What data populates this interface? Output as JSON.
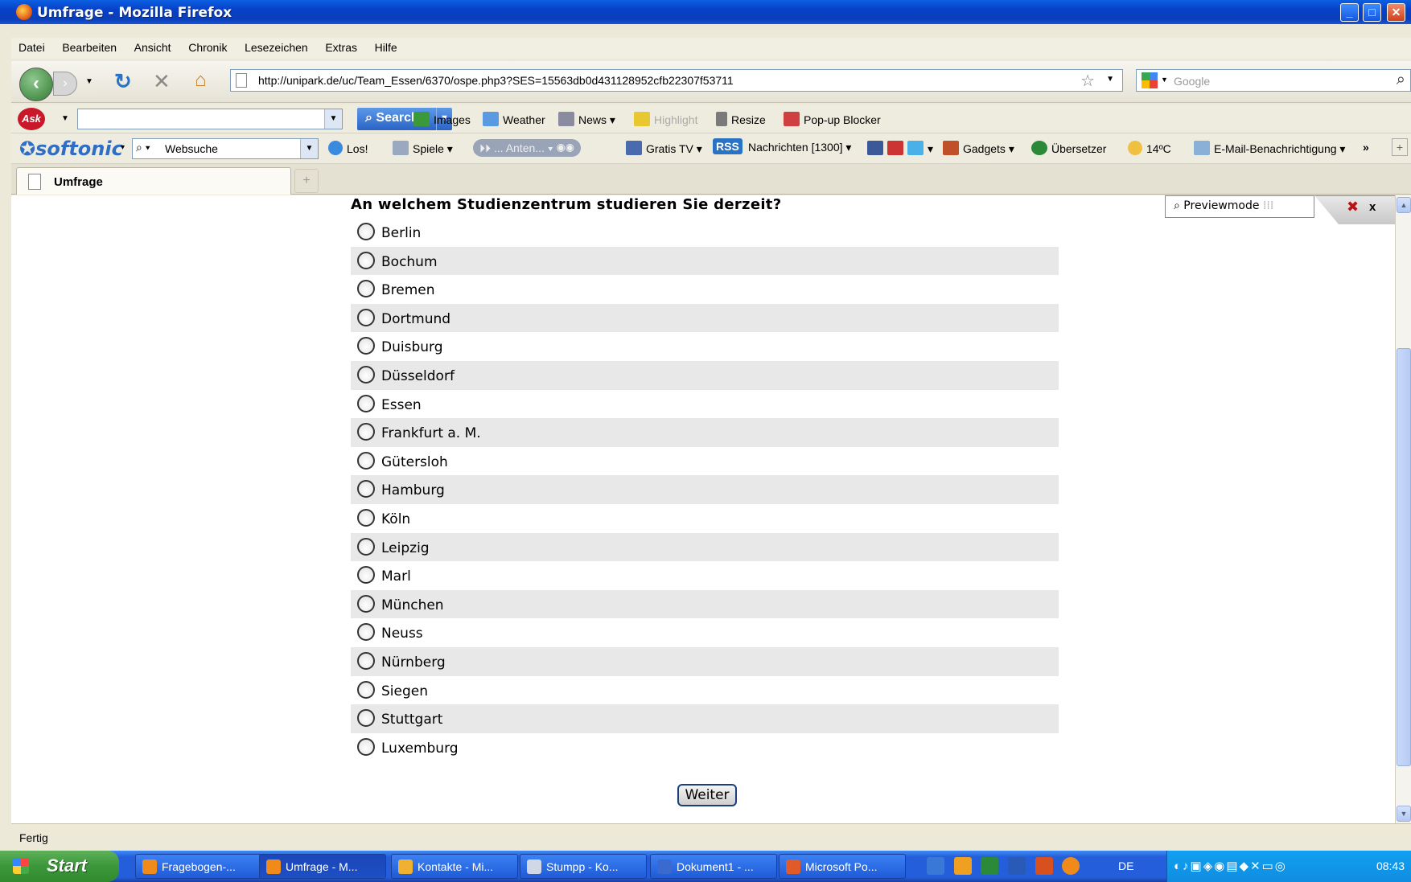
{
  "window": {
    "title": "Umfrage - Mozilla Firefox"
  },
  "menu": [
    "Datei",
    "Bearbeiten",
    "Ansicht",
    "Chronik",
    "Lesezeichen",
    "Extras",
    "Hilfe"
  ],
  "nav": {
    "url": "http://unipark.de/uc/Team_Essen/6370/ospe.php3?SES=15563db0d431128952cfb22307f53711",
    "search_placeholder": "Google"
  },
  "ask_toolbar": {
    "search_label": "Search",
    "items": [
      "Images",
      "Weather",
      "News",
      "Highlight",
      "Resize",
      "Pop-up Blocker"
    ]
  },
  "softonic_toolbar": {
    "logo": "softonic",
    "search_value": "Websuche",
    "items": [
      "Los!",
      "Spiele",
      "Anten...",
      "Gratis TV",
      "RSS",
      "Nachrichten [1300]",
      "Gadgets",
      "Übersetzer",
      "14ºC",
      "E-Mail-Benachrichtigung",
      "»",
      "+"
    ]
  },
  "tabs": [
    {
      "label": "Umfrage",
      "active": true
    }
  ],
  "survey": {
    "question": "An welchem Studienzentrum studieren Sie derzeit?",
    "options": [
      "Berlin",
      "Bochum",
      "Bremen",
      "Dortmund",
      "Duisburg",
      "Düsseldorf",
      "Essen",
      "Frankfurt a. M.",
      "Gütersloh",
      "Hamburg",
      "Köln",
      "Leipzig",
      "Marl",
      "München",
      "Neuss",
      "Nürnberg",
      "Siegen",
      "Stuttgart",
      "Luxemburg"
    ],
    "submit_label": "Weiter"
  },
  "preview": {
    "label": "Previewmode",
    "close": "x"
  },
  "status": "Fertig",
  "taskbar": {
    "start": "Start",
    "tasks": [
      {
        "label": "Fragebogen-...",
        "color": "#f08a1a"
      },
      {
        "label": "Umfrage - M...",
        "color": "#f08a1a",
        "active": true
      },
      {
        "label": "Kontakte - Mi...",
        "color": "#f0b030"
      },
      {
        "label": "Stumpp - Ko...",
        "color": "#d0d8e8"
      },
      {
        "label": "Dokument1 - ...",
        "color": "#3a6ad0"
      },
      {
        "label": "Microsoft Po...",
        "color": "#e05a2a"
      }
    ],
    "language": "DE",
    "clock": "08:43"
  }
}
